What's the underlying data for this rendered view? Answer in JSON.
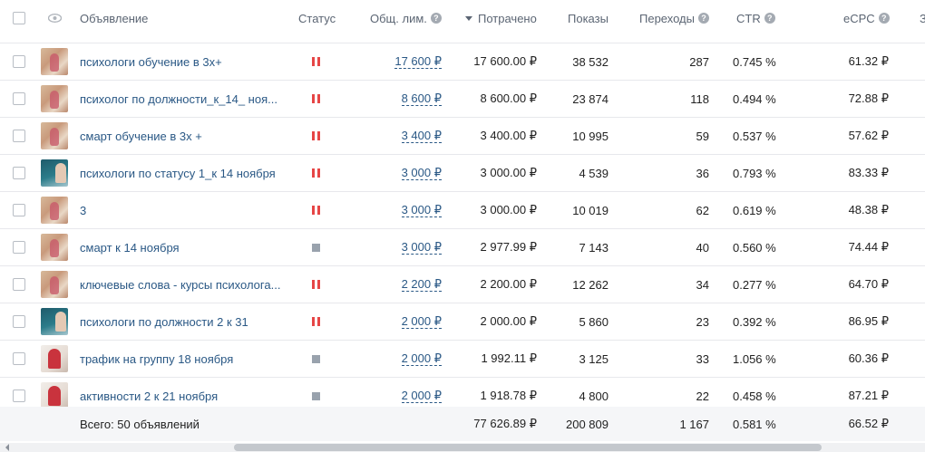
{
  "columns": {
    "ad": "Объявление",
    "status": "Статус",
    "limit": "Общ. лим.",
    "spent": "Потрачено",
    "impressions": "Показы",
    "clicks": "Переходы",
    "ctr": "CTR",
    "ecpc": "eCPC",
    "next_cut": "З"
  },
  "rows": [
    {
      "thumb": "thumb-a",
      "name": "психологи обучение в 3х+",
      "status": "paused",
      "limit": "17 600 ₽",
      "spent": "17 600.00 ₽",
      "impressions": "38 532",
      "clicks": "287",
      "ctr": "0.745 %",
      "ecpc": "61.32 ₽"
    },
    {
      "thumb": "thumb-a",
      "name": "психолог по должности_к_14_ ноя...",
      "status": "paused",
      "limit": "8 600 ₽",
      "spent": "8 600.00 ₽",
      "impressions": "23 874",
      "clicks": "118",
      "ctr": "0.494 %",
      "ecpc": "72.88 ₽"
    },
    {
      "thumb": "thumb-a",
      "name": "смарт обучение в 3х +",
      "status": "paused",
      "limit": "3 400 ₽",
      "spent": "3 400.00 ₽",
      "impressions": "10 995",
      "clicks": "59",
      "ctr": "0.537 %",
      "ecpc": "57.62 ₽"
    },
    {
      "thumb": "thumb-b",
      "name": "психологи по статусу 1_к 14 ноября",
      "status": "paused",
      "limit": "3 000 ₽",
      "spent": "3 000.00 ₽",
      "impressions": "4 539",
      "clicks": "36",
      "ctr": "0.793 %",
      "ecpc": "83.33 ₽"
    },
    {
      "thumb": "thumb-a",
      "name": "3",
      "status": "paused",
      "limit": "3 000 ₽",
      "spent": "3 000.00 ₽",
      "impressions": "10 019",
      "clicks": "62",
      "ctr": "0.619 %",
      "ecpc": "48.38 ₽"
    },
    {
      "thumb": "thumb-a",
      "name": "смарт к 14 ноября",
      "status": "stopped",
      "limit": "3 000 ₽",
      "spent": "2 977.99 ₽",
      "impressions": "7 143",
      "clicks": "40",
      "ctr": "0.560 %",
      "ecpc": "74.44 ₽"
    },
    {
      "thumb": "thumb-a",
      "name": "ключевые слова - курсы психолога...",
      "status": "paused",
      "limit": "2 200 ₽",
      "spent": "2 200.00 ₽",
      "impressions": "12 262",
      "clicks": "34",
      "ctr": "0.277 %",
      "ecpc": "64.70 ₽"
    },
    {
      "thumb": "thumb-b",
      "name": "психологи по должности 2 к 31",
      "status": "paused",
      "limit": "2 000 ₽",
      "spent": "2 000.00 ₽",
      "impressions": "5 860",
      "clicks": "23",
      "ctr": "0.392 %",
      "ecpc": "86.95 ₽"
    },
    {
      "thumb": "thumb-c",
      "name": "трафик на группу 18 ноября",
      "status": "stopped",
      "limit": "2 000 ₽",
      "spent": "1 992.11 ₽",
      "impressions": "3 125",
      "clicks": "33",
      "ctr": "1.056 %",
      "ecpc": "60.36 ₽"
    },
    {
      "thumb": "thumb-c",
      "name": "активности 2 к 21 ноября",
      "status": "stopped",
      "limit": "2 000 ₽",
      "spent": "1 918.78 ₽",
      "impressions": "4 800",
      "clicks": "22",
      "ctr": "0.458 %",
      "ecpc": "87.21 ₽"
    }
  ],
  "totals": {
    "label": "Всего: 50 объявлений",
    "spent": "77 626.89 ₽",
    "impressions": "200 809",
    "clicks": "1 167",
    "ctr": "0.581 %",
    "ecpc": "66.52 ₽"
  },
  "icons": {
    "help": "?",
    "eye": "👁"
  },
  "colors": {
    "link": "#2a5885",
    "paused": "#e64646",
    "stopped": "#99a2ad"
  }
}
